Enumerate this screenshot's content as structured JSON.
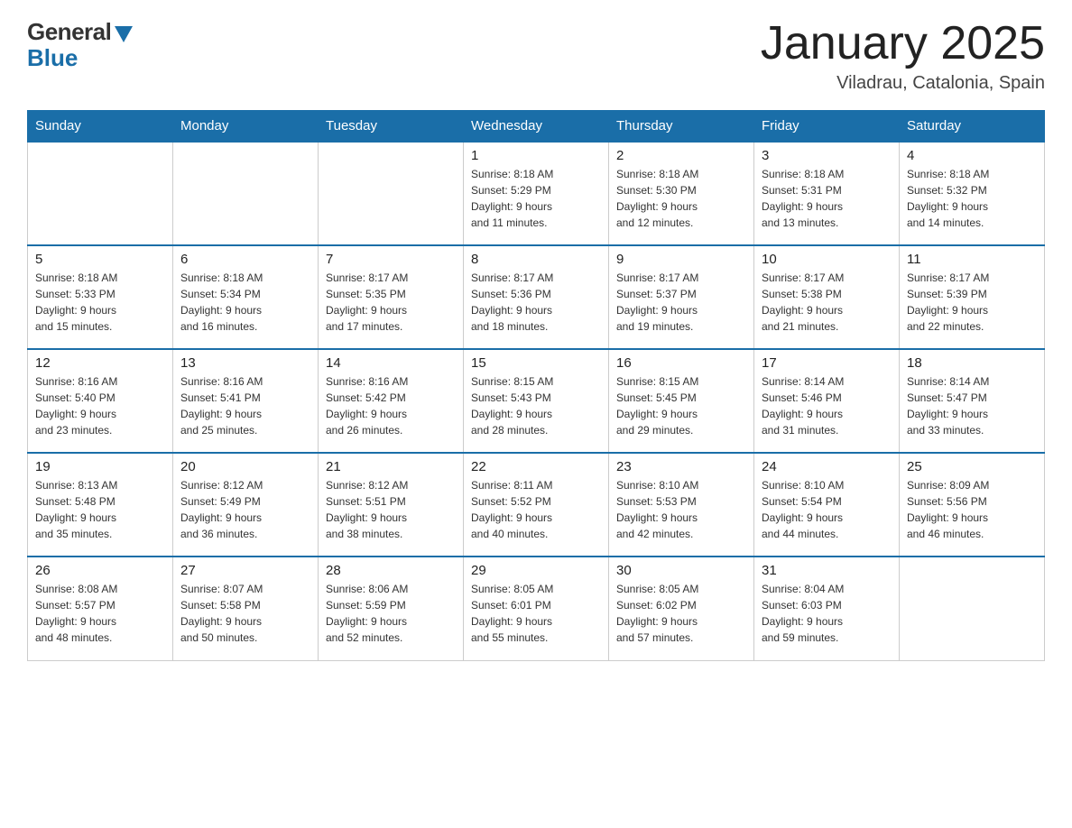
{
  "header": {
    "logo_general": "General",
    "logo_blue": "Blue",
    "month_title": "January 2025",
    "location": "Viladrau, Catalonia, Spain"
  },
  "calendar": {
    "days_of_week": [
      "Sunday",
      "Monday",
      "Tuesday",
      "Wednesday",
      "Thursday",
      "Friday",
      "Saturday"
    ],
    "weeks": [
      [
        {
          "day": "",
          "info": ""
        },
        {
          "day": "",
          "info": ""
        },
        {
          "day": "",
          "info": ""
        },
        {
          "day": "1",
          "info": "Sunrise: 8:18 AM\nSunset: 5:29 PM\nDaylight: 9 hours\nand 11 minutes."
        },
        {
          "day": "2",
          "info": "Sunrise: 8:18 AM\nSunset: 5:30 PM\nDaylight: 9 hours\nand 12 minutes."
        },
        {
          "day": "3",
          "info": "Sunrise: 8:18 AM\nSunset: 5:31 PM\nDaylight: 9 hours\nand 13 minutes."
        },
        {
          "day": "4",
          "info": "Sunrise: 8:18 AM\nSunset: 5:32 PM\nDaylight: 9 hours\nand 14 minutes."
        }
      ],
      [
        {
          "day": "5",
          "info": "Sunrise: 8:18 AM\nSunset: 5:33 PM\nDaylight: 9 hours\nand 15 minutes."
        },
        {
          "day": "6",
          "info": "Sunrise: 8:18 AM\nSunset: 5:34 PM\nDaylight: 9 hours\nand 16 minutes."
        },
        {
          "day": "7",
          "info": "Sunrise: 8:17 AM\nSunset: 5:35 PM\nDaylight: 9 hours\nand 17 minutes."
        },
        {
          "day": "8",
          "info": "Sunrise: 8:17 AM\nSunset: 5:36 PM\nDaylight: 9 hours\nand 18 minutes."
        },
        {
          "day": "9",
          "info": "Sunrise: 8:17 AM\nSunset: 5:37 PM\nDaylight: 9 hours\nand 19 minutes."
        },
        {
          "day": "10",
          "info": "Sunrise: 8:17 AM\nSunset: 5:38 PM\nDaylight: 9 hours\nand 21 minutes."
        },
        {
          "day": "11",
          "info": "Sunrise: 8:17 AM\nSunset: 5:39 PM\nDaylight: 9 hours\nand 22 minutes."
        }
      ],
      [
        {
          "day": "12",
          "info": "Sunrise: 8:16 AM\nSunset: 5:40 PM\nDaylight: 9 hours\nand 23 minutes."
        },
        {
          "day": "13",
          "info": "Sunrise: 8:16 AM\nSunset: 5:41 PM\nDaylight: 9 hours\nand 25 minutes."
        },
        {
          "day": "14",
          "info": "Sunrise: 8:16 AM\nSunset: 5:42 PM\nDaylight: 9 hours\nand 26 minutes."
        },
        {
          "day": "15",
          "info": "Sunrise: 8:15 AM\nSunset: 5:43 PM\nDaylight: 9 hours\nand 28 minutes."
        },
        {
          "day": "16",
          "info": "Sunrise: 8:15 AM\nSunset: 5:45 PM\nDaylight: 9 hours\nand 29 minutes."
        },
        {
          "day": "17",
          "info": "Sunrise: 8:14 AM\nSunset: 5:46 PM\nDaylight: 9 hours\nand 31 minutes."
        },
        {
          "day": "18",
          "info": "Sunrise: 8:14 AM\nSunset: 5:47 PM\nDaylight: 9 hours\nand 33 minutes."
        }
      ],
      [
        {
          "day": "19",
          "info": "Sunrise: 8:13 AM\nSunset: 5:48 PM\nDaylight: 9 hours\nand 35 minutes."
        },
        {
          "day": "20",
          "info": "Sunrise: 8:12 AM\nSunset: 5:49 PM\nDaylight: 9 hours\nand 36 minutes."
        },
        {
          "day": "21",
          "info": "Sunrise: 8:12 AM\nSunset: 5:51 PM\nDaylight: 9 hours\nand 38 minutes."
        },
        {
          "day": "22",
          "info": "Sunrise: 8:11 AM\nSunset: 5:52 PM\nDaylight: 9 hours\nand 40 minutes."
        },
        {
          "day": "23",
          "info": "Sunrise: 8:10 AM\nSunset: 5:53 PM\nDaylight: 9 hours\nand 42 minutes."
        },
        {
          "day": "24",
          "info": "Sunrise: 8:10 AM\nSunset: 5:54 PM\nDaylight: 9 hours\nand 44 minutes."
        },
        {
          "day": "25",
          "info": "Sunrise: 8:09 AM\nSunset: 5:56 PM\nDaylight: 9 hours\nand 46 minutes."
        }
      ],
      [
        {
          "day": "26",
          "info": "Sunrise: 8:08 AM\nSunset: 5:57 PM\nDaylight: 9 hours\nand 48 minutes."
        },
        {
          "day": "27",
          "info": "Sunrise: 8:07 AM\nSunset: 5:58 PM\nDaylight: 9 hours\nand 50 minutes."
        },
        {
          "day": "28",
          "info": "Sunrise: 8:06 AM\nSunset: 5:59 PM\nDaylight: 9 hours\nand 52 minutes."
        },
        {
          "day": "29",
          "info": "Sunrise: 8:05 AM\nSunset: 6:01 PM\nDaylight: 9 hours\nand 55 minutes."
        },
        {
          "day": "30",
          "info": "Sunrise: 8:05 AM\nSunset: 6:02 PM\nDaylight: 9 hours\nand 57 minutes."
        },
        {
          "day": "31",
          "info": "Sunrise: 8:04 AM\nSunset: 6:03 PM\nDaylight: 9 hours\nand 59 minutes."
        },
        {
          "day": "",
          "info": ""
        }
      ]
    ]
  }
}
